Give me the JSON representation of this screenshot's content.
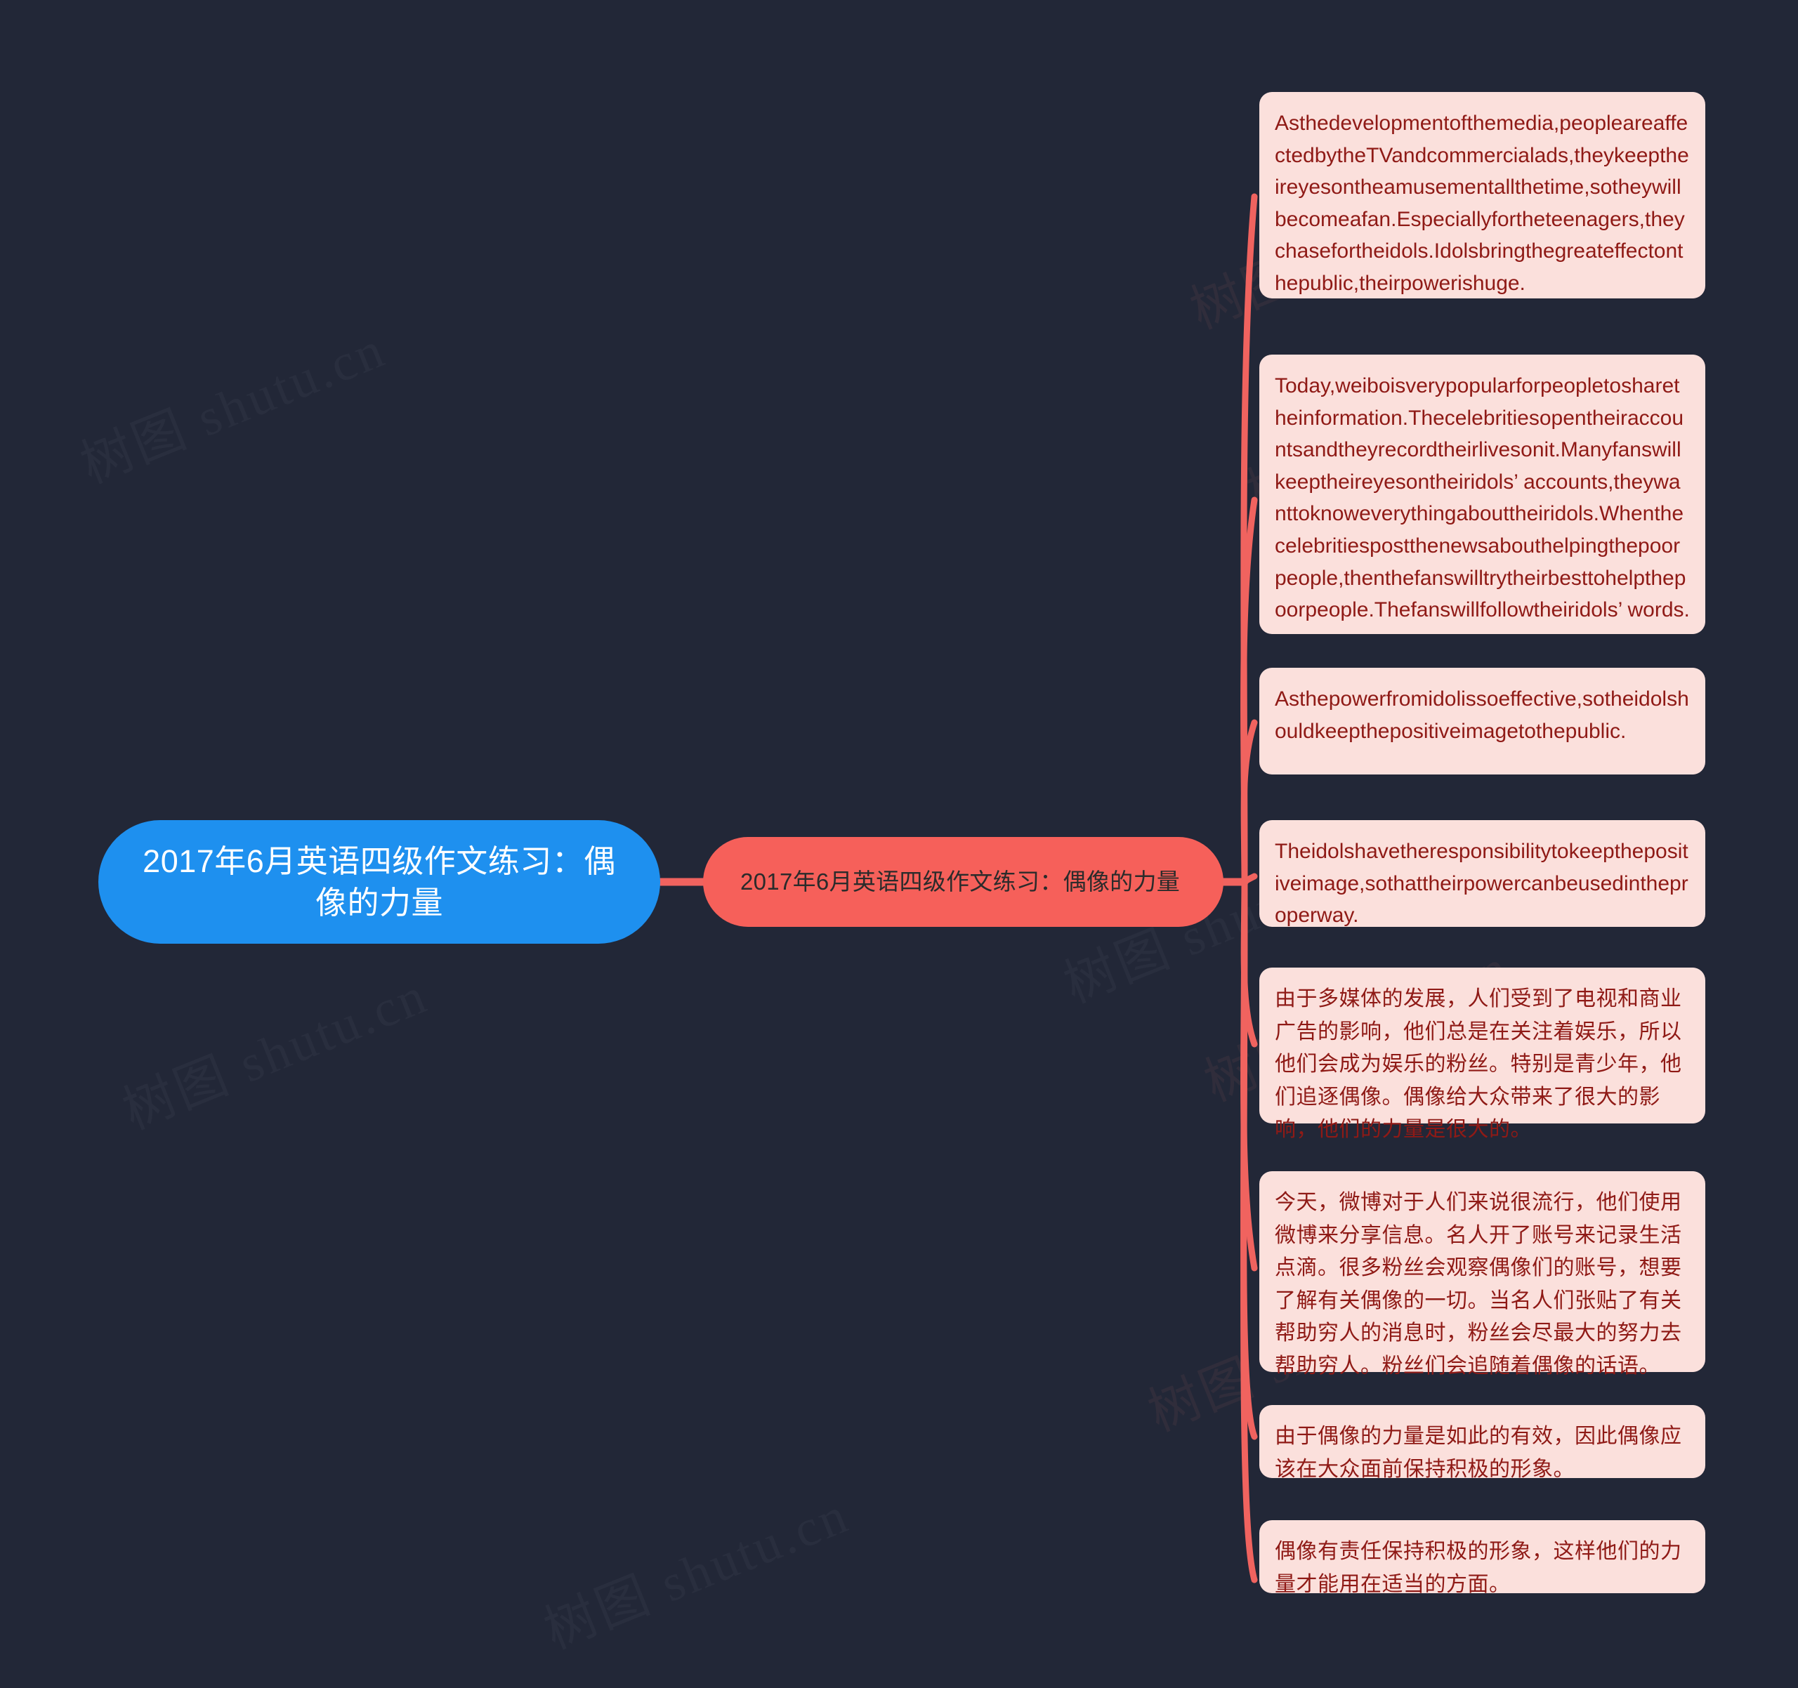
{
  "canvas": {
    "background_color": "#222737",
    "watermark_text": "树图 shutu.cn"
  },
  "mindmap": {
    "root": {
      "label": "2017年6月英语四级作文练习：偶像的力量",
      "color": "#1E90EF",
      "text_color": "#FFFFFF"
    },
    "topic": {
      "label": "2017年6月英语四级作文练习：偶像的力量",
      "color": "#F6605A",
      "text_color": "#2B2B2B"
    },
    "branch_color": "#F0635F",
    "leaf_bg_color": "#FBE0DC",
    "leaf_text_color": "#8F1A16",
    "leaves": [
      {
        "id": "leaf-1",
        "lang": "en",
        "text": "Asthedevelopmentofthemedia,peopleareaffectedbytheTVandcommercialads,theykeeptheireyesontheamusementallthetime,sotheywillbecomeafan.Especiallyfortheteenagers,theychasefortheidols.Idolsbringthegreateffectonthepublic,theirpowerishuge."
      },
      {
        "id": "leaf-2",
        "lang": "en",
        "text": "Today,weiboisverypopularforpeopletosharetheinformation.Thecelebritiesopentheiraccountsandtheyrecordtheirlivesonit.Manyfanswillkeeptheireyesontheiridols’  accounts,theywanttoknoweverythingabouttheiridols.Whenthecelebritiespostthenewsabouthelpingthepoorpeople,thenthefanswilltrytheirbesttohelpthepoorpeople.Thefanswillfollowtheiridols’  words."
      },
      {
        "id": "leaf-3",
        "lang": "en",
        "text": "Asthepowerfromidolissoeffective,sotheidolshouldkeepthepositiveimagetothepublic."
      },
      {
        "id": "leaf-4",
        "lang": "en",
        "text": "Theidolshavetheresponsibilitytokeepthepositiveimage,sothattheirpowercanbeusedintheproperway."
      },
      {
        "id": "leaf-5",
        "lang": "zh",
        "text": "由于多媒体的发展，人们受到了电视和商业广告的影响，他们总是在关注着娱乐，所以他们会成为娱乐的粉丝。特别是青少年，他们追逐偶像。偶像给大众带来了很大的影响，他们的力量是很大的。"
      },
      {
        "id": "leaf-6",
        "lang": "zh",
        "text": "今天，微博对于人们来说很流行，他们使用微博来分享信息。名人开了账号来记录生活点滴。很多粉丝会观察偶像们的账号，想要了解有关偶像的一切。当名人们张贴了有关帮助穷人的消息时，粉丝会尽最大的努力去帮助穷人。粉丝们会追随着偶像的话语。"
      },
      {
        "id": "leaf-7",
        "lang": "zh",
        "text": "由于偶像的力量是如此的有效，因此偶像应该在大众面前保持积极的形象。"
      },
      {
        "id": "leaf-8",
        "lang": "zh",
        "text": "偶像有责任保持积极的形象，这样他们的力量才能用在适当的方面。"
      }
    ]
  }
}
